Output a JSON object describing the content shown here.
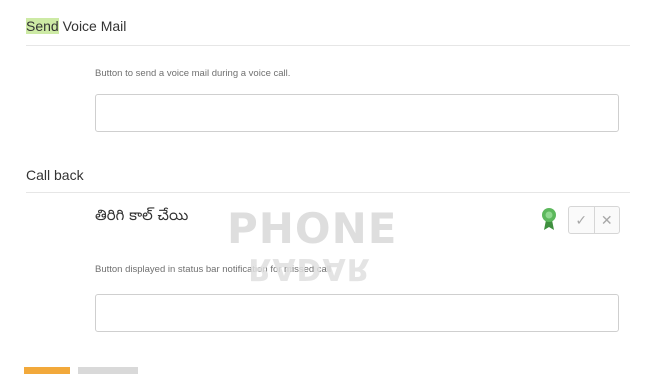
{
  "send_voice_mail": {
    "title_highlight": "Send",
    "title_rest": " Voice Mail",
    "hint": "Button to send a voice mail during a voice call.",
    "input_value": ""
  },
  "call_back": {
    "title": "Call back",
    "translation": "తిరిగి కాల్ చేయి",
    "hint": "Button displayed in status bar notification for missed call",
    "input_value": "",
    "approve_icon": "ribbon-badge-icon",
    "accept_icon": "check-icon",
    "accept_glyph": "✓",
    "reject_icon": "close-icon",
    "reject_glyph": "✕",
    "approve_color": "#5cb85c"
  },
  "watermark": {
    "line1": "PHONE",
    "line2": "RADAR"
  },
  "colors": {
    "highlight": "#cdeaa5",
    "next_section_accent": "#f2a93b"
  }
}
